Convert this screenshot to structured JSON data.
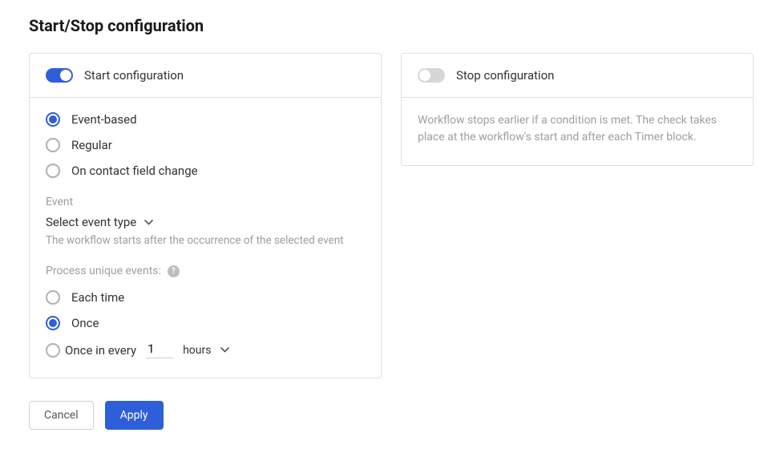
{
  "page": {
    "title": "Start/Stop configuration"
  },
  "start_panel": {
    "title": "Start configuration",
    "toggle_on": true,
    "trigger_options": {
      "event_based": "Event-based",
      "regular": "Regular",
      "on_field_change": "On contact field change",
      "selected": "event_based"
    },
    "event_section": {
      "label": "Event",
      "select_placeholder": "Select event type",
      "helper": "The workflow starts after the occurrence of the selected event"
    },
    "process_unique": {
      "label": "Process unique events:",
      "options": {
        "each_time": "Each time",
        "once": "Once",
        "once_in_every": "Once in every",
        "selected": "once"
      },
      "interval_value": "1",
      "interval_unit": "hours"
    }
  },
  "stop_panel": {
    "title": "Stop configuration",
    "toggle_on": false,
    "description": "Workflow stops earlier if a condition is met. The check takes place at the workflow's start and after each Timer block."
  },
  "footer": {
    "cancel": "Cancel",
    "apply": "Apply"
  }
}
